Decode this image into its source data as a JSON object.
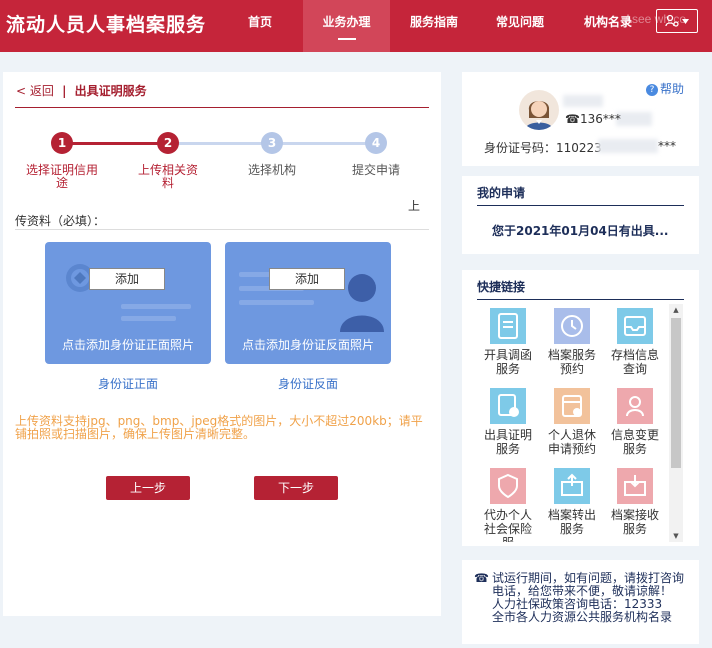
{
  "header": {
    "title": "流动人员人事档案服务",
    "nav": [
      {
        "label": "首页",
        "active": false
      },
      {
        "label": "业务办理",
        "active": true
      },
      {
        "label": "服务指南",
        "active": false
      },
      {
        "label": "常见问题",
        "active": false
      },
      {
        "label": "机构名录",
        "active": false
      }
    ],
    "watermark": "Asee wh.co",
    "user_button_icon": "user-switch-icon"
  },
  "breadcrumb": {
    "back": "< 返回",
    "separator": "|",
    "current": "出具证明服务"
  },
  "steps": [
    {
      "num": "1",
      "label": "选择证明信用途",
      "state": "done"
    },
    {
      "num": "2",
      "label": "上传相关资料",
      "state": "done"
    },
    {
      "num": "3",
      "label": "选择机构",
      "state": "todo"
    },
    {
      "num": "4",
      "label": "提交申请",
      "state": "todo"
    }
  ],
  "upload": {
    "header_tail": "上",
    "header_text": "传资料（必填）：",
    "front": {
      "add_label": "添加",
      "caption": "点击添加身份证正面照片",
      "label": "身份证正面"
    },
    "back": {
      "add_label": "添加",
      "caption": "点击添加身份证反面照片",
      "label": "身份证反面"
    },
    "notice": "上传资料支持jpg、png、bmp、jpeg格式的图片，大小不超过200kb；请平铺拍照或扫描图片，确保上传图片清晰完整。"
  },
  "buttons": {
    "prev": "上一步",
    "next": "下一步"
  },
  "user_card": {
    "help": "帮助",
    "phone": "136***",
    "id_label": "身份证号码：110223",
    "id_tail": "***"
  },
  "applications": {
    "title": "我的申请",
    "item": "您于2021年01月04日有出具..."
  },
  "quick_links": {
    "title": "快捷链接",
    "items": [
      {
        "label": "开具调函服务",
        "color": "#7ecae8",
        "icon": "document-icon"
      },
      {
        "label": "档案服务预约",
        "color": "#a9bdea",
        "icon": "clock-icon"
      },
      {
        "label": "存档信息查询",
        "color": "#7ecae8",
        "icon": "inbox-icon"
      },
      {
        "label": "出具证明服务",
        "color": "#7ecae8",
        "icon": "certificate-icon"
      },
      {
        "label": "个人退休申请预约",
        "color": "#f2c29b",
        "icon": "calendar-icon"
      },
      {
        "label": "信息变更服务",
        "color": "#eea8ad",
        "icon": "person-icon"
      },
      {
        "label": "代办个人社会保险服",
        "color": "#eea8ad",
        "icon": "shield-icon"
      },
      {
        "label": "档案转出服务",
        "color": "#7ecae8",
        "icon": "export-icon"
      },
      {
        "label": "档案接收服务",
        "color": "#eea8ad",
        "icon": "import-icon"
      }
    ]
  },
  "contact": {
    "line1": "试运行期间，如有问题，请拨打咨询电话，给您带来不便，敬请谅解！",
    "line2": "人力社保政策咨询电话：12333",
    "line3": "全市各人力资源公共服务机构名录"
  },
  "colors": {
    "brand": "#c5253a",
    "accent": "#b52234",
    "navy": "#1d2e59",
    "link": "#3a72c9",
    "card_blue": "#6e98e0",
    "notice": "#f0a24a"
  }
}
